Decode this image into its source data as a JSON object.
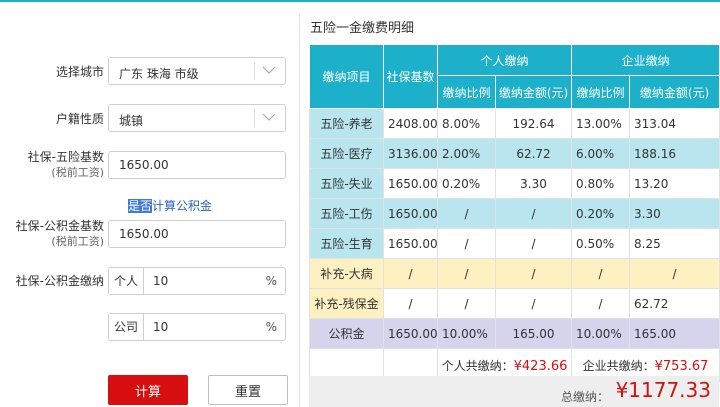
{
  "form": {
    "city_label": "选择城市",
    "city_value": "广东 珠海 市级",
    "hukou_label": "户籍性质",
    "hukou_value": "城镇",
    "si_base_label": "社保-五险基数",
    "si_base_sub": "(税前工资)",
    "si_base_value": "1650.00",
    "fund_link_pre": "是否",
    "fund_link_rest": "计算公积金",
    "fund_base_label": "社保-公积金基数",
    "fund_base_sub": "(税前工资)",
    "fund_base_value": "1650.00",
    "fund_pay_label": "社保-公积金缴纳",
    "personal_prefix": "个人",
    "personal_value": "10",
    "company_prefix": "公司",
    "company_value": "10",
    "percent": "%",
    "calc_button": "计算",
    "reset_button": "重置"
  },
  "table": {
    "title": "五险一金缴费明细",
    "headers": {
      "item": "缴纳项目",
      "base": "社保基数",
      "personal": "个人缴纳",
      "company": "企业缴纳",
      "rate": "缴纳比例",
      "amount": "缴纳金额(元)"
    },
    "rows": [
      {
        "name": "五险-养老",
        "base": "2408.00",
        "p_rate": "8.00%",
        "p_amt": "192.64",
        "c_rate": "13.00%",
        "c_amt": "313.04"
      },
      {
        "name": "五险-医疗",
        "base": "3136.00",
        "p_rate": "2.00%",
        "p_amt": "62.72",
        "c_rate": "6.00%",
        "c_amt": "188.16"
      },
      {
        "name": "五险-失业",
        "base": "1650.00",
        "p_rate": "0.20%",
        "p_amt": "3.30",
        "c_rate": "0.80%",
        "c_amt": "13.20"
      },
      {
        "name": "五险-工伤",
        "base": "1650.00",
        "p_rate": "/",
        "p_amt": "/",
        "c_rate": "0.20%",
        "c_amt": "3.30"
      },
      {
        "name": "五险-生育",
        "base": "1650.00",
        "p_rate": "/",
        "p_amt": "/",
        "c_rate": "0.50%",
        "c_amt": "8.25"
      },
      {
        "name": "补充-大病",
        "base": "/",
        "p_rate": "/",
        "p_amt": "/",
        "c_rate": "/",
        "c_amt": "/"
      },
      {
        "name": "补充-残保金",
        "base": "/",
        "p_rate": "/",
        "p_amt": "/",
        "c_rate": "/",
        "c_amt": "62.72"
      },
      {
        "name": "公积金",
        "base": "1650.00",
        "p_rate": "10.00%",
        "p_amt": "165.00",
        "c_rate": "10.00%",
        "c_amt": "165.00"
      }
    ],
    "personal_total_label": "个人共缴纳：",
    "personal_total_value": "¥423.66",
    "company_total_label": "企业共缴纳：",
    "company_total_value": "¥753.67",
    "grand_total_label": "总缴纳：",
    "grand_total_value": "¥1177.33"
  },
  "colors": {
    "header": "#1cb0cb",
    "teal_cell": "#b9e6ee",
    "yellow_cell": "#fdf1c1",
    "lavender_cell": "#d6d3ec",
    "accent_red": "#d70f11"
  }
}
